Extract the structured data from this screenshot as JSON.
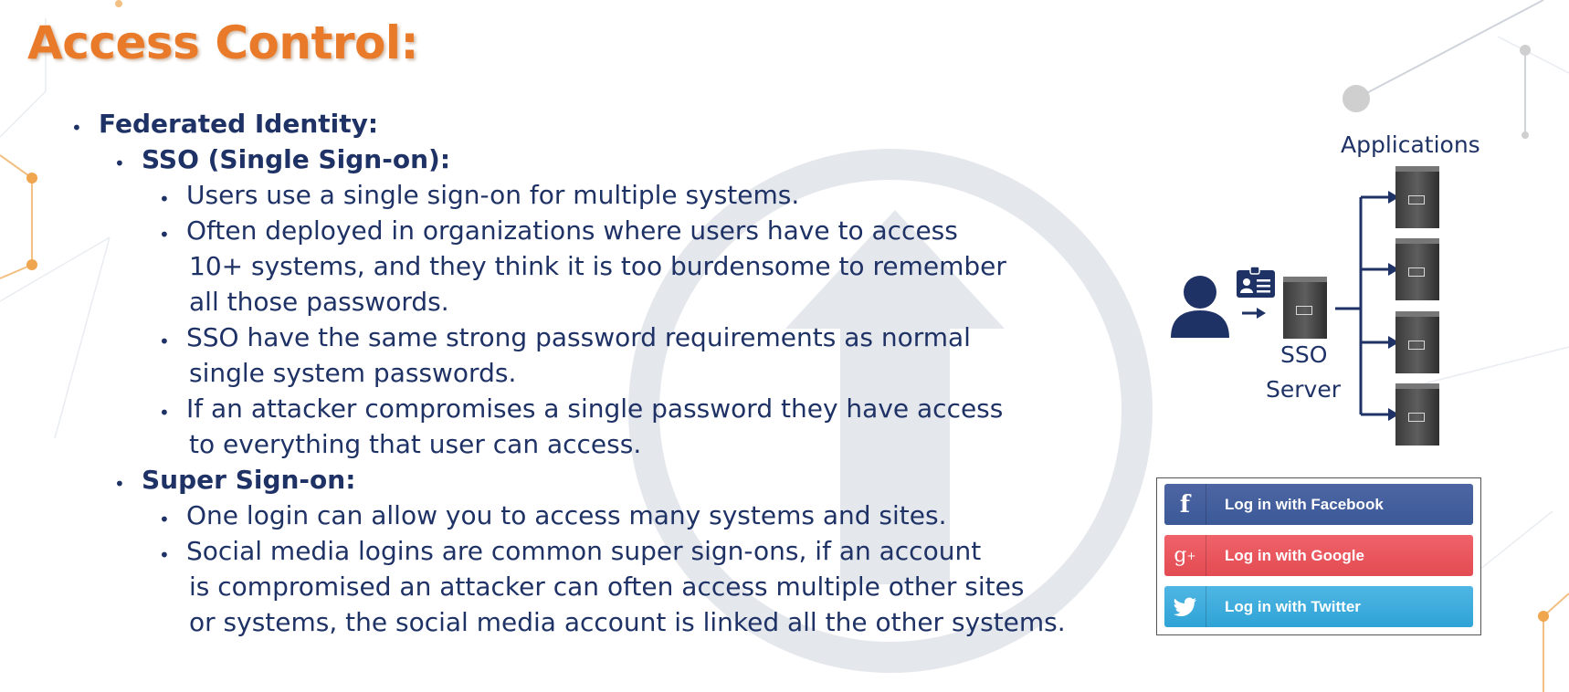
{
  "title": "Access Control:",
  "outline": {
    "federated": "Federated Identity:",
    "sso_heading": "SSO (Single Sign-on):",
    "sso_points": [
      [
        "Users use a single sign-on for multiple systems."
      ],
      [
        "Often deployed in organizations where users have to access",
        "10+ systems, and they think it is too burdensome to remember",
        "all those passwords."
      ],
      [
        "SSO have the same strong password requirements as normal",
        "single system passwords."
      ],
      [
        "If an attacker compromises a single password they have access",
        "to everything that user can access."
      ]
    ],
    "super_heading": "Super Sign-on:",
    "super_points": [
      [
        "One login can allow you to access many systems and sites."
      ],
      [
        "Social media logins are common super sign-ons, if an account",
        "is compromised an attacker can often access multiple other sites",
        "or systems, the social media account is linked all the other systems."
      ]
    ]
  },
  "diagram": {
    "applications_label": "Applications",
    "sso_label_line1": "SSO",
    "sso_label_line2": "Server",
    "icons": [
      "user-icon",
      "id-card-icon",
      "server-icon"
    ]
  },
  "social_login": {
    "facebook": "Log in with Facebook",
    "google": "Log in with Google",
    "twitter": "Log in with Twitter",
    "colors": {
      "facebook": "#3b5998",
      "google": "#e34b52",
      "twitter": "#2fa3d6"
    }
  },
  "colors": {
    "title": "#e87a2a",
    "text": "#1f3266"
  }
}
